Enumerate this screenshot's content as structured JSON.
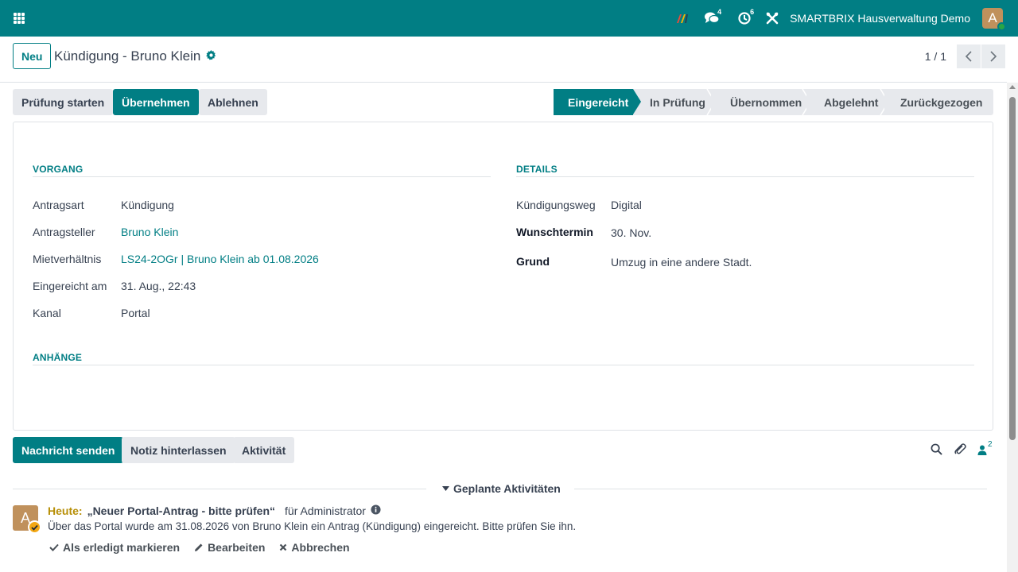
{
  "navbar": {
    "messages_badge": "4",
    "activities_badge": "6",
    "company": "SMARTBRIX Hausverwaltung Demo",
    "user_initial": "A"
  },
  "control": {
    "new_label": "Neu",
    "title": "Kündigung - Bruno Klein",
    "pager": "1 / 1"
  },
  "actions": {
    "start_review": "Prüfung starten",
    "accept": "Übernehmen",
    "reject": "Ablehnen"
  },
  "stages": [
    {
      "label": "Eingereicht",
      "active": true
    },
    {
      "label": "In Prüfung",
      "active": false
    },
    {
      "label": "Übernommen",
      "active": false
    },
    {
      "label": "Abgelehnt",
      "active": false
    },
    {
      "label": "Zurückgezogen",
      "active": false
    }
  ],
  "form": {
    "vorgang": {
      "title": "VORGANG",
      "fields": [
        {
          "label": "Antragsart",
          "value": "Kündigung"
        },
        {
          "label": "Antragsteller",
          "value": "Bruno Klein"
        },
        {
          "label": "Mietverhältnis",
          "value": "LS24-2OGr | Bruno Klein ab 01.08.2026"
        },
        {
          "label": "Eingereicht am",
          "value": "31. Aug., 22:43"
        },
        {
          "label": "Kanal",
          "value": "Portal"
        }
      ]
    },
    "details": {
      "title": "DETAILS",
      "fields": [
        {
          "label": "Kündigungsweg",
          "value": "Digital"
        },
        {
          "label": "Wunschtermin",
          "value": "30. Nov."
        },
        {
          "label": "Grund",
          "value": "Umzug in eine andere Stadt."
        }
      ]
    },
    "anhaenge": {
      "title": "ANHÄNGE"
    }
  },
  "chatter": {
    "send_message": "Nachricht senden",
    "log_note": "Notiz hinterlassen",
    "activity": "Aktivität",
    "followers_count": "2",
    "planned_label": "Geplante Aktivitäten",
    "activity_item": {
      "avatar_initial": "A",
      "today": "Heute:",
      "summary": "„Neuer Portal-Antrag - bitte prüfen“",
      "for": "für Administrator",
      "description": "Über das Portal wurde am 31.08.2026 von Bruno Klein ein Antrag (Kündigung) eingereicht. Bitte prüfen Sie ihn.",
      "mark_done": "Als erledigt markieren",
      "edit": "Bearbeiten",
      "cancel": "Abbrechen"
    }
  },
  "colors": {
    "primary": "#017e84",
    "today": "#b78f07",
    "avatar": "#c0915c"
  }
}
